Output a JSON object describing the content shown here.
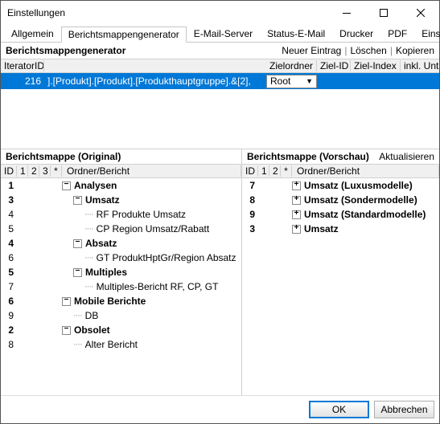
{
  "window": {
    "title": "Einstellungen"
  },
  "tabs": [
    "Allgemein",
    "Berichtsmappengenerator",
    "E-Mail-Server",
    "Status-E-Mail",
    "Drucker",
    "PDF",
    "Einste"
  ],
  "active_tab": 1,
  "section_title": "Berichtsmappengenerator",
  "actions": {
    "new": "Neuer Eintrag",
    "delete": "Löschen",
    "copy": "Kopieren"
  },
  "grid": {
    "headers": {
      "id": "IteratorID",
      "ziel": "Zielordner",
      "zielid": "Ziel-ID",
      "zielidx": "Ziel-Index",
      "inkl": "inkl. Unt"
    },
    "row": {
      "id": "216",
      "iterator": "].[Produkt].[Produkt].[Produkthauptgruppe].&[2],",
      "ziel": "Root"
    }
  },
  "panes": {
    "left_title": "Berichtsmappe (Original)",
    "right_title": "Berichtsmappe (Vorschau)",
    "refresh": "Aktualisieren",
    "tree_headers": {
      "id": "ID",
      "c1": "1",
      "c2": "2",
      "c3": "3",
      "star": "*",
      "name": "Ordner/Bericht"
    }
  },
  "tree_left": [
    {
      "id": "1",
      "indent": 0,
      "exp": "-",
      "label": "Analysen",
      "bold": true
    },
    {
      "id": "3",
      "indent": 1,
      "exp": "-",
      "label": "Umsatz",
      "bold": true
    },
    {
      "id": "4",
      "indent": 2,
      "leaf": true,
      "label": "RF Produkte Umsatz"
    },
    {
      "id": "5",
      "indent": 2,
      "leaf": true,
      "label": "CP Region Umsatz/Rabatt"
    },
    {
      "id": "4",
      "indent": 1,
      "exp": "-",
      "label": "Absatz",
      "bold": true
    },
    {
      "id": "6",
      "indent": 2,
      "leaf": true,
      "label": "GT ProduktHptGr/Region Absatz"
    },
    {
      "id": "5",
      "indent": 1,
      "exp": "-",
      "label": "Multiples",
      "bold": true
    },
    {
      "id": "7",
      "indent": 2,
      "leaf": true,
      "label": "Multiples-Bericht RF, CP, GT"
    },
    {
      "id": "6",
      "indent": 0,
      "exp": "-",
      "label": "Mobile Berichte",
      "bold": true
    },
    {
      "id": "9",
      "indent": 1,
      "leaf": true,
      "label": "DB"
    },
    {
      "id": "2",
      "indent": 0,
      "exp": "-",
      "label": "Obsolet",
      "bold": true
    },
    {
      "id": "8",
      "indent": 1,
      "leaf": true,
      "label": "Alter Bericht"
    }
  ],
  "tree_right": [
    {
      "id": "7",
      "indent": 0,
      "exp": "+",
      "label": "Umsatz (Luxusmodelle)",
      "bold": true
    },
    {
      "id": "8",
      "indent": 0,
      "exp": "+",
      "label": "Umsatz (Sondermodelle)",
      "bold": true
    },
    {
      "id": "9",
      "indent": 0,
      "exp": "+",
      "label": "Umsatz (Standardmodelle)",
      "bold": true
    },
    {
      "id": "3",
      "indent": 0,
      "exp": "+",
      "label": "Umsatz",
      "bold": true
    }
  ],
  "buttons": {
    "ok": "OK",
    "cancel": "Abbrechen"
  }
}
